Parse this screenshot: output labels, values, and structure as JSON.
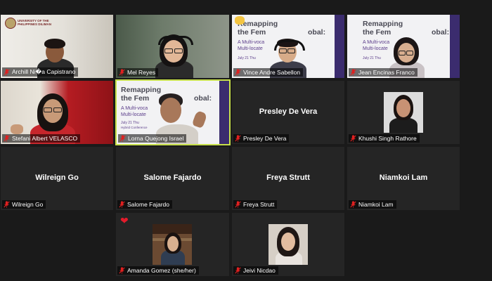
{
  "participants": [
    {
      "name": "Archill Ni�a Capistrano",
      "muted": true,
      "video": true
    },
    {
      "name": "Mel Reyes",
      "muted": true,
      "video": true
    },
    {
      "name": "Vince Andre Sabellon",
      "muted": true,
      "video": true
    },
    {
      "name": "Jean Encinas Franco",
      "muted": true,
      "video": true
    },
    {
      "name": "Stefani Albert VELASCO",
      "muted": true,
      "video": true
    },
    {
      "name": "Lorna Quejong Israel",
      "muted": true,
      "video": true,
      "active_speaker": true
    },
    {
      "name": "Presley De Vera",
      "muted": true,
      "video": false
    },
    {
      "name": "Khushi Singh Rathore",
      "muted": true,
      "video": true
    },
    {
      "name": "Wilreign Go",
      "muted": true,
      "video": false
    },
    {
      "name": "Salome Fajardo",
      "muted": true,
      "video": false
    },
    {
      "name": "Freya Strutt",
      "muted": true,
      "video": false
    },
    {
      "name": "Niamkoi Lam",
      "muted": true,
      "video": false
    },
    {
      "name": "Amanda Gomez (she/her)",
      "muted": true,
      "video": false,
      "reaction": "heart"
    },
    {
      "name": "Jeivi Nicdao",
      "muted": true,
      "video": false
    }
  ],
  "slide": {
    "title_line1": "Remapping",
    "title_line2": "the Fem",
    "title_line2b": "obal:",
    "subtitle1": "A Multi-voca",
    "subtitle2": "Multi-locate",
    "date": "July 21 Thu",
    "conference": "Hybrid Conference"
  },
  "logo_text": "UNIVERSITY OF THE PHILIPPINES DILIMAN",
  "colors": {
    "background": "#1a1a1a",
    "tile": "#252525",
    "active_border": "#c7e04a",
    "mute_icon": "#e02020",
    "slide_accent": "#3b2c6e"
  }
}
